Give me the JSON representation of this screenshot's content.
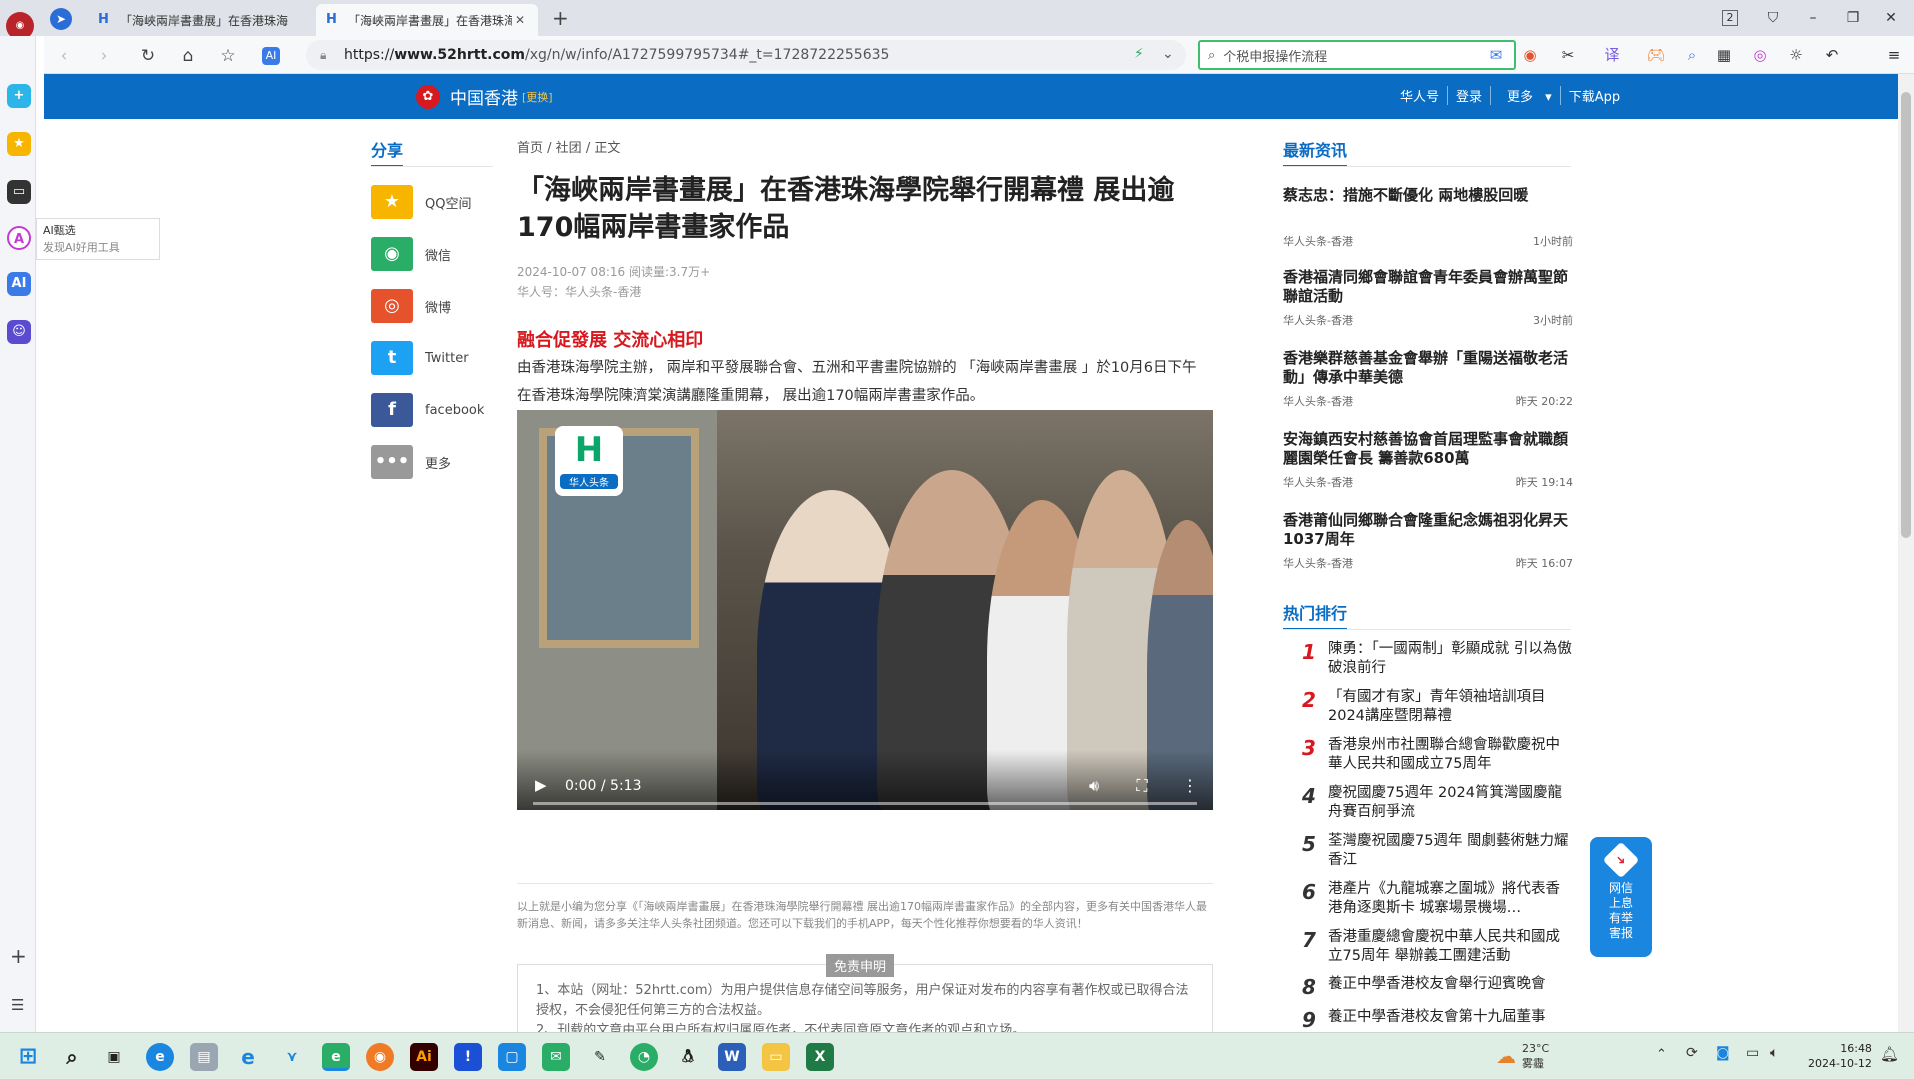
{
  "browser": {
    "tabs": [
      {
        "label": "「海峽兩岸書畫展」在香港珠海"
      },
      {
        "label": "「海峽兩岸書畫展」在香港珠海"
      }
    ],
    "new_tab_symbol": "+",
    "tab_count_badge": "2",
    "url": {
      "prefix": "https://",
      "domain": "www.52hrtt.com",
      "path": "/xg/n/w/info/A1727599795734#_t=1728722255635"
    },
    "search_value": "个税申报操作流程"
  },
  "sidebar_tip": {
    "title": "AI甄选",
    "subtitle": "发现AI好用工具"
  },
  "site": {
    "logo_text": "中国香港",
    "switch_label": "[更换]",
    "nav": [
      "华人号",
      "登录",
      "更多",
      "下载App"
    ]
  },
  "share": {
    "title": "分享",
    "items": [
      {
        "label": "QQ空间",
        "icon": "qzone-star-icon",
        "color": "#f7b500"
      },
      {
        "label": "微信",
        "icon": "wechat-icon",
        "color": "#2aae67"
      },
      {
        "label": "微博",
        "icon": "weibo-icon",
        "color": "#e6522c"
      },
      {
        "label": "Twitter",
        "icon": "twitter-icon",
        "color": "#1da1f2"
      },
      {
        "label": "facebook",
        "icon": "facebook-icon",
        "color": "#3b5998"
      },
      {
        "label": "更多",
        "icon": "more-dots-icon",
        "color": "#999999"
      }
    ]
  },
  "article": {
    "breadcrumb": [
      "首页",
      "社团",
      "正文"
    ],
    "title": "「海峽兩岸書畫展」在香港珠海學院舉行開幕禮 展出逾170幅兩岸書畫家作品",
    "date_views": "2024-10-07 08:16 阅读量:3.7万+",
    "source": "华人号：华人头条-香港",
    "subheading": "融合促發展 交流心相印",
    "lead": "由香港珠海學院主辦， 兩岸和平發展聯合會、五洲和平書畫院協辦的 「海峽兩岸書畫展 」於10月6日下午在香港珠海學院陳濟棠演講廳隆重開幕， 展出逾170幅兩岸書畫家作品。",
    "video": {
      "logo_text": "华人头条",
      "time": "0:00 / 5:13"
    },
    "summary_note": "以上就是小编为您分享《「海峽兩岸書畫展」在香港珠海學院舉行開幕禮 展出逾170幅兩岸書畫家作品》的全部内容，更多有关中国香港华人最新消息、新闻，请多多关注华人头条社团频道。您还可以下载我们的手机APP，每天个性化推荐你想要看的华人资讯！",
    "disclaimer_label": "免责申明",
    "disclaimer_1": "1、本站（网址：52hrtt.com）为用户提供信息存储空间等服务，用户保证对发布的内容享有著作权或已取得合法授权，不会侵犯任何第三方的合法权益。",
    "disclaimer_2": "2、刊载的文章由平台用户所有权归属原作者，不代表同意原文章作者的观点和立场。"
  },
  "latest": {
    "title": "最新资讯",
    "items": [
      {
        "headline": "蔡志忠：措施不斷優化 兩地樓股回暖",
        "source": "华人头条-香港",
        "time": "1小时前"
      },
      {
        "headline": "香港福清同鄉會聯誼會青年委員會辦萬聖節聯誼活動",
        "source": "华人头条-香港",
        "time": "3小时前"
      },
      {
        "headline": "香港樂群慈善基金會舉辦「重陽送福敬老活動」傳承中華美德",
        "source": "华人头条-香港",
        "time": "昨天 20:22"
      },
      {
        "headline": "安海鎮西安村慈善協會首屆理監事會就職顏麗園榮任會長 籌善款680萬",
        "source": "华人头条-香港",
        "time": "昨天 19:14"
      },
      {
        "headline": "香港莆仙同鄉聯合會隆重紀念媽祖羽化昇天1037周年",
        "source": "华人头条-香港",
        "time": "昨天 16:07"
      }
    ]
  },
  "hot": {
    "title": "热门排行",
    "items": [
      {
        "rank": "1",
        "text": "陳勇：「一國兩制」彰顯成就 引以為傲破浪前行"
      },
      {
        "rank": "2",
        "text": "「有國才有家」青年領袖培訓項目2024講座暨閉幕禮"
      },
      {
        "rank": "3",
        "text": "香港泉州市社團聯合總會聯歡慶祝中華人民共和國成立75周年"
      },
      {
        "rank": "4",
        "text": "慶祝國慶75週年 2024筲箕灣國慶龍舟賽百舸爭流"
      },
      {
        "rank": "5",
        "text": "荃灣慶祝國慶75週年 閩劇藝術魅力耀香江"
      },
      {
        "rank": "6",
        "text": "港產片《九龍城寨之圍城》將代表香港角逐奧斯卡 城寨場景機場…"
      },
      {
        "rank": "7",
        "text": "香港重慶總會慶祝中華人民共和國成立75周年 舉辦義工團建活動"
      },
      {
        "rank": "8",
        "text": "養正中學香港校友會舉行迎賓晚會"
      },
      {
        "rank": "9",
        "text": "養正中學香港校友會第十九屆董事"
      }
    ]
  },
  "report_widget": {
    "label": "网信上息有举害报"
  },
  "taskbar": {
    "temperature": "23°C",
    "weather": "雾霾",
    "time": "16:48",
    "date": "2024-10-12"
  }
}
